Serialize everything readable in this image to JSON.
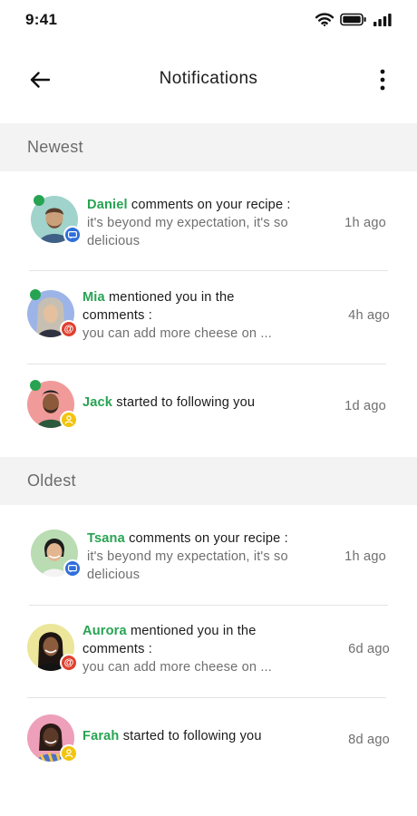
{
  "status_bar": {
    "time": "9:41"
  },
  "header": {
    "title": "Notifications"
  },
  "sections": [
    {
      "title": "Newest"
    },
    {
      "title": "Oldest"
    }
  ],
  "notifications": [
    {
      "name": "Daniel",
      "action": "comments on your recipe :",
      "preview_lines": [
        "it's beyond my expectation, it's so",
        "delicious"
      ],
      "time": "1h ago",
      "type": "comment",
      "online": true
    },
    {
      "name": "Mia",
      "action": "mentioned you in the",
      "action_line2": "comments :",
      "preview": "you can add more cheese on ...",
      "time": "4h ago",
      "type": "mention",
      "online": true
    },
    {
      "name": "Jack",
      "action": "started to following you",
      "time": "1d ago",
      "type": "follow",
      "online": true
    },
    {
      "name": "Tsana",
      "action": "comments on your recipe :",
      "preview_lines": [
        "it's beyond my expectation, it's so",
        "delicious"
      ],
      "time": "1h ago",
      "type": "comment",
      "online": false
    },
    {
      "name": "Aurora",
      "action": "mentioned you in the",
      "action_line2": "comments :",
      "preview": "you can add more cheese on ...",
      "time": "6d ago",
      "type": "mention",
      "online": false
    },
    {
      "name": "Farah",
      "action": "started to following you",
      "time": "8d ago",
      "type": "follow",
      "online": false
    }
  ],
  "colors": {
    "name_accent": "#27a352",
    "online_dot": "#27a352",
    "comment_badge": "#2f6fdb",
    "mention_badge": "#e0402f",
    "follow_badge": "#f2c40f",
    "section_bg": "#f3f3f3"
  },
  "icons": {
    "back": "arrow-left-icon",
    "more": "more-vertical-icon",
    "comment_badge": "chat-bubble-icon",
    "mention_badge": "at-sign-icon",
    "follow_badge": "user-icon"
  }
}
